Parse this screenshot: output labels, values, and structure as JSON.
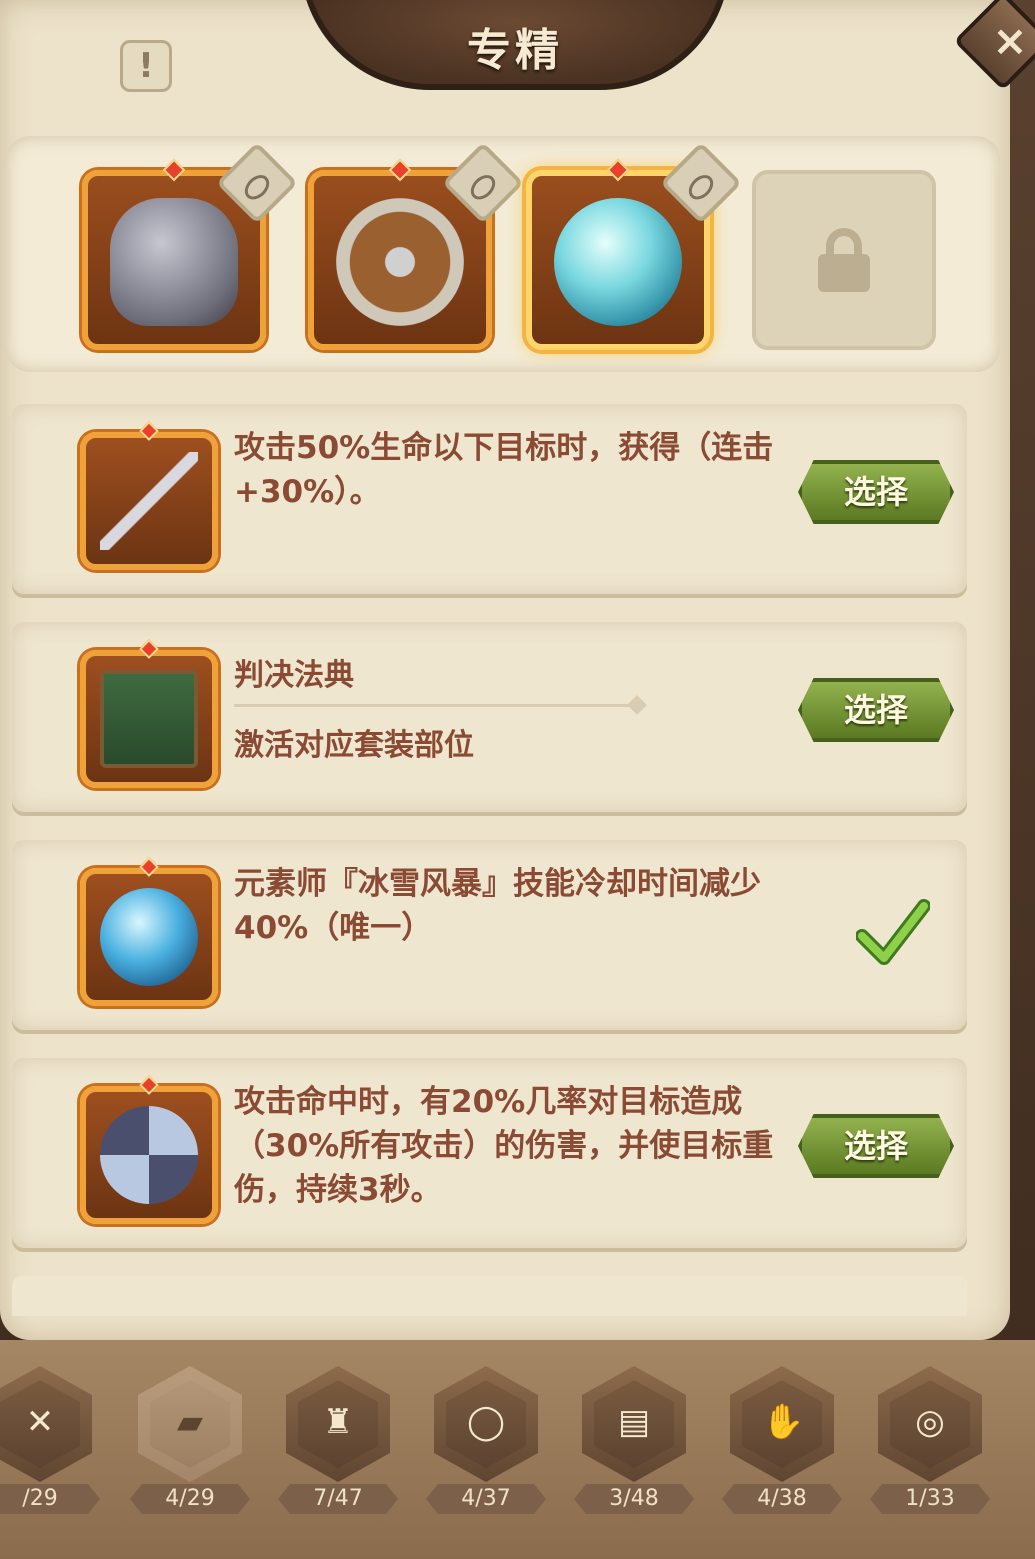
{
  "header": {
    "title": "专精",
    "info_label": "!",
    "close_label": "×"
  },
  "slots": [
    {
      "name": "helmet",
      "selected": false,
      "locked": false
    },
    {
      "name": "shield",
      "selected": false,
      "locked": false
    },
    {
      "name": "ice-orb",
      "selected": true,
      "locked": false
    },
    {
      "name": "locked-slot",
      "selected": false,
      "locked": true
    }
  ],
  "options": [
    {
      "icon": "kunai-icon",
      "text": "攻击50%生命以下目标时，获得（连击+30%）。",
      "button": "选择",
      "state": "select"
    },
    {
      "icon": "book-icon",
      "title": "判决法典",
      "subtitle": "激活对应套装部位",
      "button": "选择",
      "state": "select"
    },
    {
      "icon": "ice-orb-icon",
      "text": "元素师『冰雪风暴』技能冷却时间减少40%（唯一）",
      "button": "",
      "state": "selected"
    },
    {
      "icon": "shuriken-icon",
      "text": "攻击命中时，有20%几率对目标造成（30%所有攻击）的伤害，并使目标重伤，持续3秒。",
      "button": "选择",
      "state": "select"
    }
  ],
  "tabs": [
    {
      "icon": "ring-icon",
      "glyph": "✕",
      "count": "/29",
      "active": false
    },
    {
      "icon": "book-icon",
      "glyph": "▰",
      "count": "4/29",
      "active": true
    },
    {
      "icon": "armor-icon",
      "glyph": "♜",
      "count": "7/47",
      "active": false
    },
    {
      "icon": "amulet-icon",
      "glyph": "◯",
      "count": "4/37",
      "active": false
    },
    {
      "icon": "chest-icon",
      "glyph": "▤",
      "count": "3/48",
      "active": false
    },
    {
      "icon": "glove-icon",
      "glyph": "✋",
      "count": "4/38",
      "active": false
    },
    {
      "icon": "ring2-icon",
      "glyph": "◎",
      "count": "1/33",
      "active": false
    }
  ],
  "colors": {
    "accent_text": "#8a4a34",
    "button_green": "#6f8f2c",
    "frame_orange": "#f0a23a"
  }
}
